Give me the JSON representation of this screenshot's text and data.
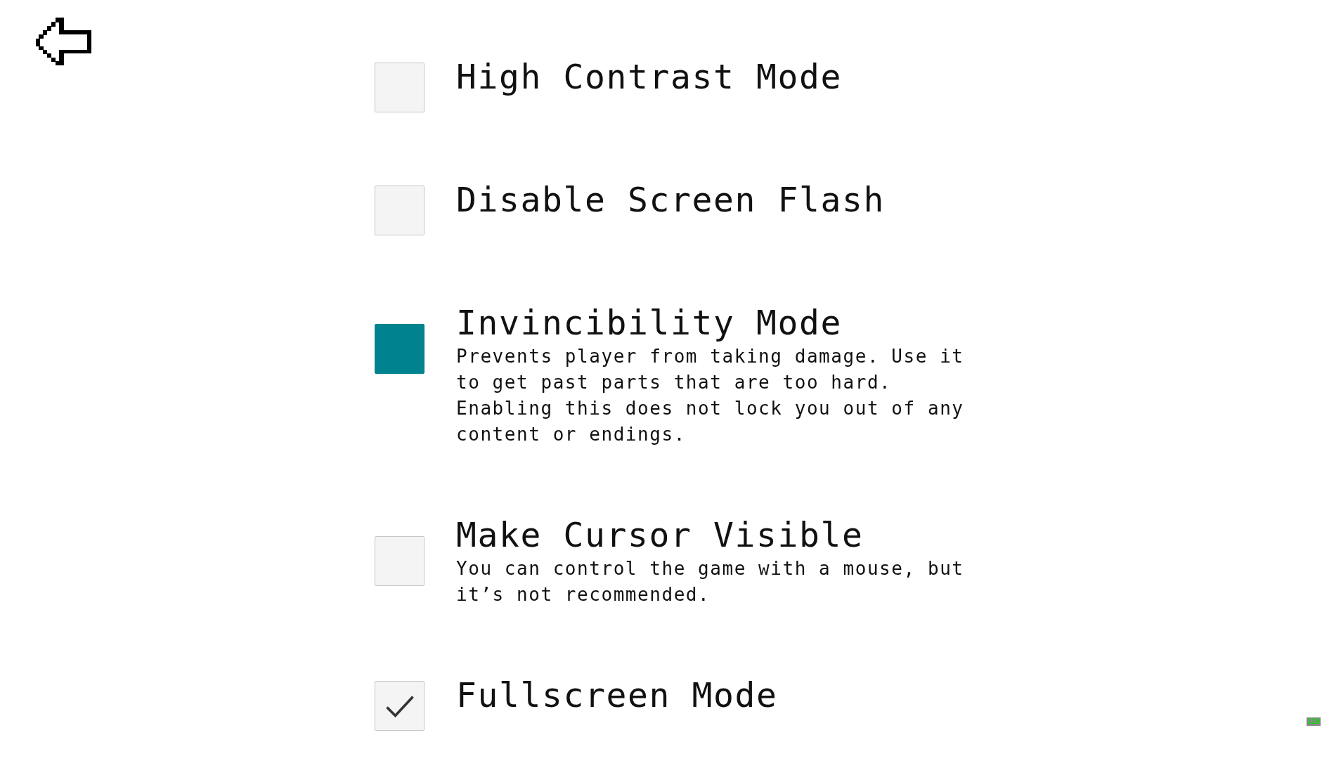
{
  "settings": [
    {
      "label": "High Contrast Mode",
      "checked": false,
      "selected": false
    },
    {
      "label": "Disable Screen Flash",
      "checked": false,
      "selected": false
    },
    {
      "label": "Invincibility Mode",
      "description": "Prevents player from taking damage. Use it to get past parts that are too hard. Enabling this does not lock you out of any content or endings.",
      "checked": false,
      "selected": true
    },
    {
      "label": "Make Cursor Visible",
      "description": "You can control the game with a mouse, but it’s not recommended.",
      "checked": false,
      "selected": false
    },
    {
      "label": "Fullscreen Mode",
      "checked": true,
      "selected": false
    }
  ],
  "fps_counter": "119"
}
